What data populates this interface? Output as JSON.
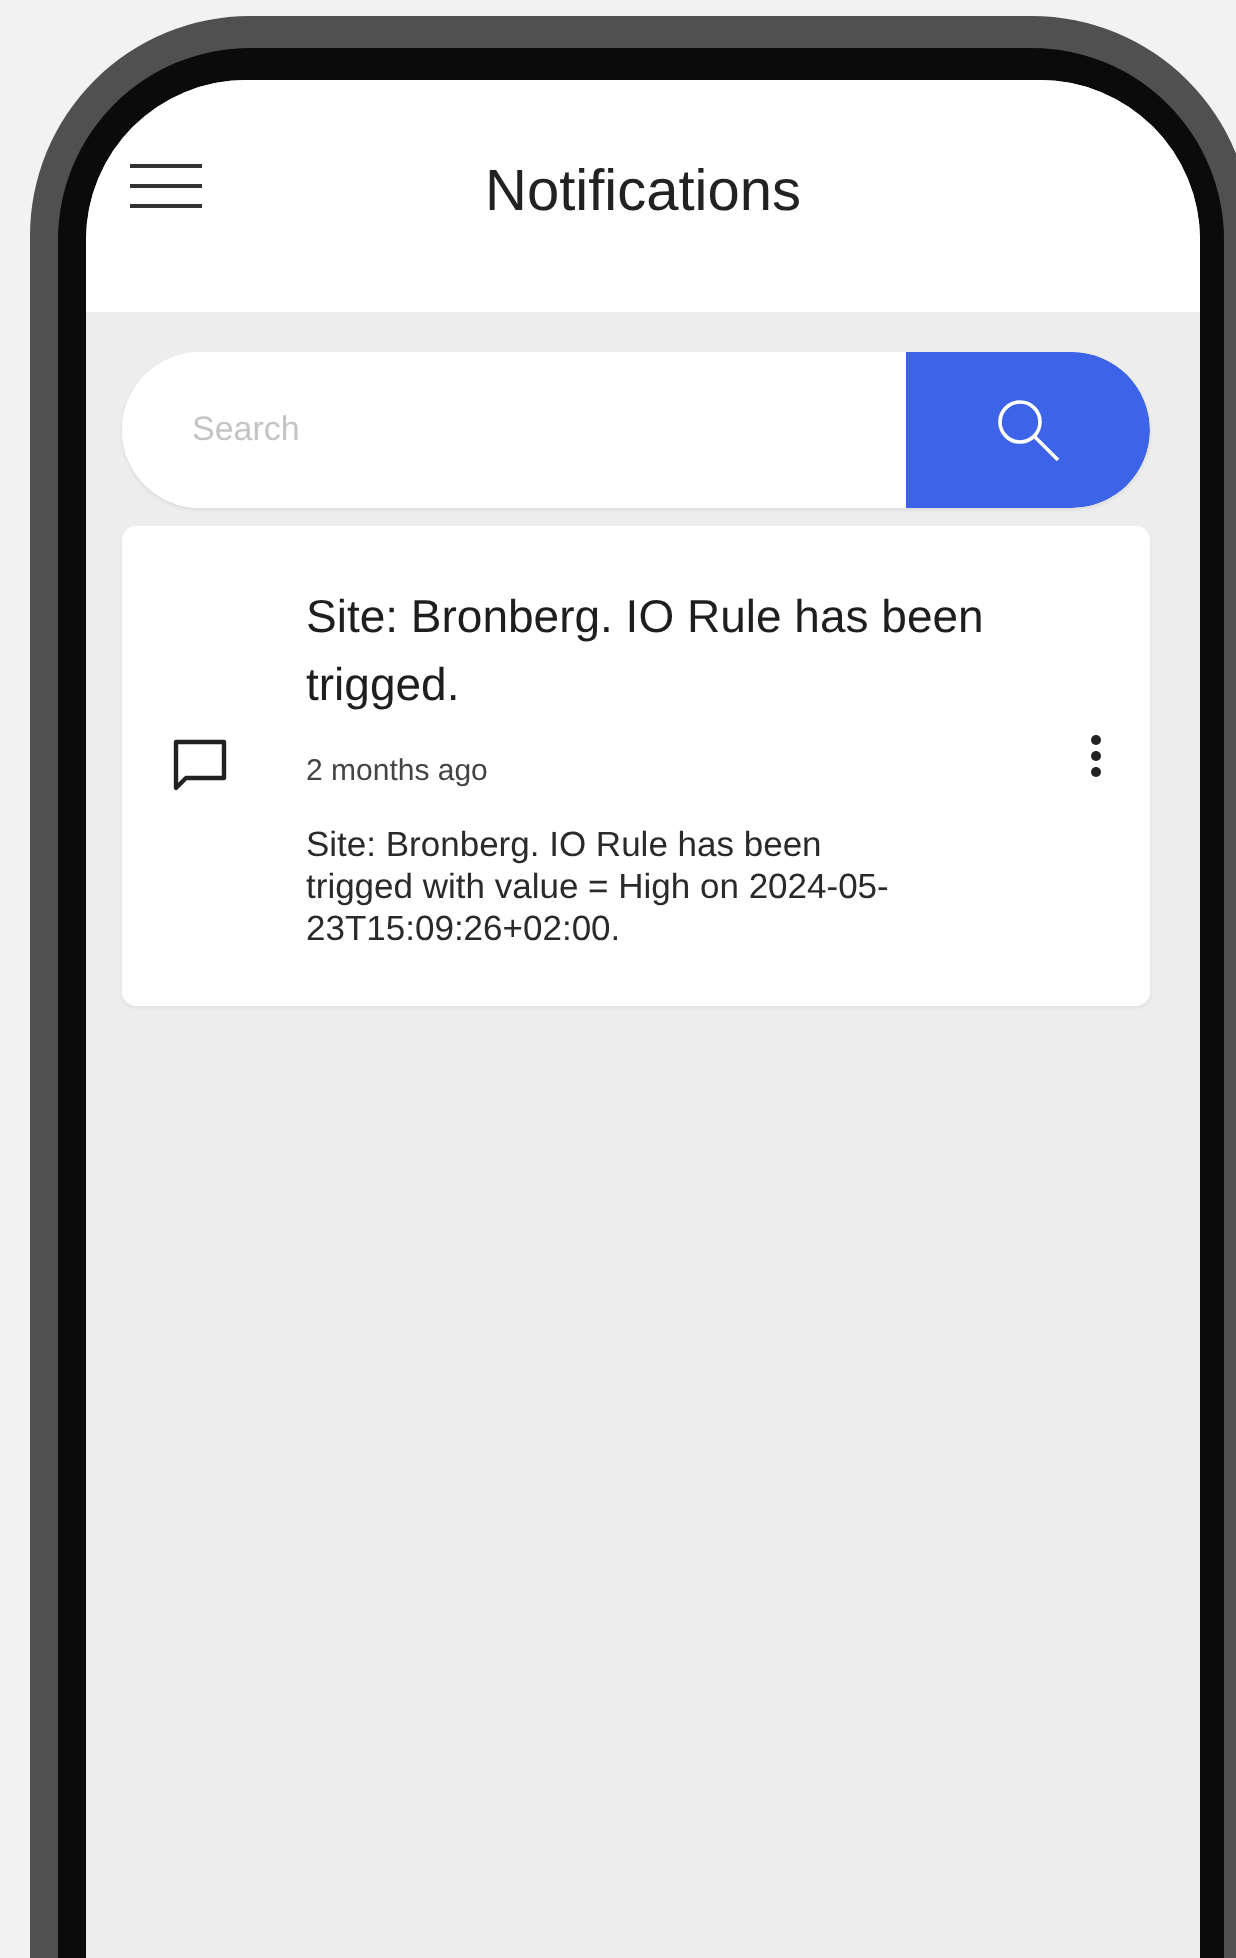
{
  "header": {
    "title": "Notifications"
  },
  "search": {
    "placeholder": "Search"
  },
  "notifications": [
    {
      "title": "Site: Bronberg. IO Rule has been trigged.",
      "time": "2 months ago",
      "message": "Site: Bronberg. IO Rule has been trigged with value = High on 2024-05-23T15:09:26+02:00."
    }
  ]
}
